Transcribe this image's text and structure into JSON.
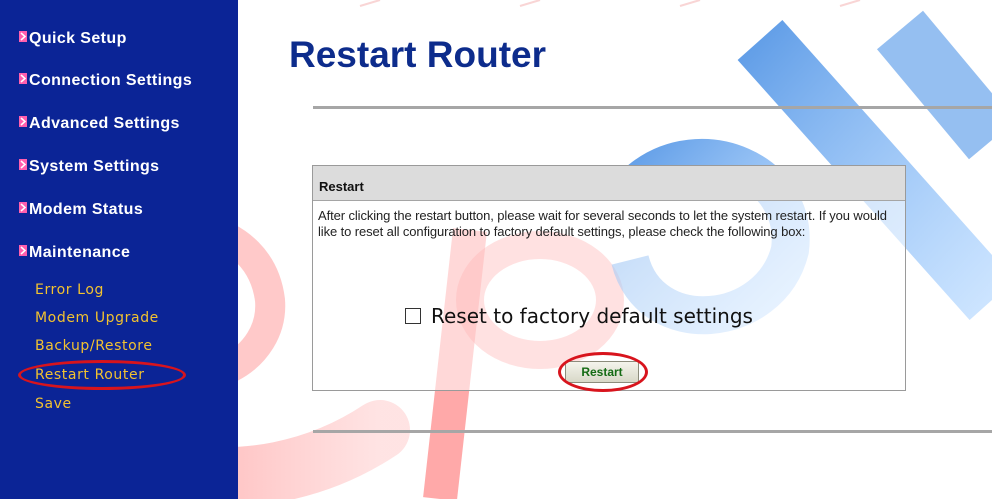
{
  "sidebar": {
    "menu": [
      {
        "label": "Quick Setup",
        "icon": "bullet-icon"
      },
      {
        "label": "Connection Settings",
        "icon": "bullet-icon"
      },
      {
        "label": "Advanced Settings",
        "icon": "bullet-icon"
      },
      {
        "label": "System Settings",
        "icon": "bullet-icon"
      },
      {
        "label": "Modem Status",
        "icon": "bullet-icon"
      },
      {
        "label": "Maintenance",
        "icon": "bullet-icon",
        "expanded": true
      }
    ],
    "maintenance_items": [
      {
        "label": "Error Log"
      },
      {
        "label": "Modem Upgrade"
      },
      {
        "label": "Backup/Restore"
      },
      {
        "label": "Restart Router",
        "highlighted": true
      },
      {
        "label": "Save"
      }
    ]
  },
  "main": {
    "title": "Restart Router",
    "panel": {
      "header": "Restart",
      "description": "After clicking the restart button, please wait for several seconds to let the system restart. If you would like to reset all configuration to factory default settings, please check the following box:",
      "checkbox_label": "Reset to factory default settings",
      "checkbox_checked": false,
      "button_label": "Restart"
    }
  },
  "colors": {
    "sidebar_bg": "#0b2496",
    "menu_text": "#ffffff",
    "submenu_text": "#f2c230",
    "title": "#0d2c8c",
    "button_text": "#146b14",
    "highlight": "#d8141d"
  }
}
